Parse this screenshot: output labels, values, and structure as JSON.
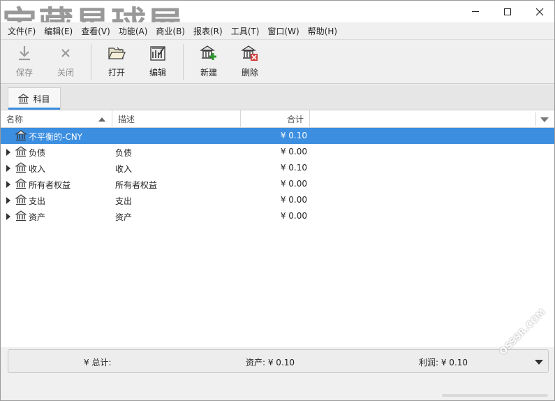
{
  "watermark": "宝藏星球屋",
  "corner_watermark": "OSSSR.COM",
  "menubar": {
    "items": [
      "文件(F)",
      "编辑(E)",
      "查看(V)",
      "功能(A)",
      "商业(B)",
      "报表(R)",
      "工具(T)",
      "窗口(W)",
      "帮助(H)"
    ]
  },
  "toolbar": {
    "save": "保存",
    "close": "关闭",
    "open": "打开",
    "edit": "编辑",
    "new": "新建",
    "delete": "删除"
  },
  "tabs": [
    {
      "label": "科目",
      "icon": "bank-icon"
    }
  ],
  "columns": {
    "name": "名称",
    "description": "描述",
    "total": "合计"
  },
  "accounts": [
    {
      "name": "不平衡的-CNY",
      "description": "",
      "total": "¥ 0.10",
      "selected": true,
      "expandable": false
    },
    {
      "name": "负债",
      "description": "负债",
      "total": "¥ 0.00",
      "selected": false,
      "expandable": true
    },
    {
      "name": "收入",
      "description": "收入",
      "total": "¥ 0.10",
      "selected": false,
      "expandable": true
    },
    {
      "name": "所有者权益",
      "description": "所有者权益",
      "total": "¥ 0.00",
      "selected": false,
      "expandable": true
    },
    {
      "name": "支出",
      "description": "支出",
      "total": "¥ 0.00",
      "selected": false,
      "expandable": true
    },
    {
      "name": "资产",
      "description": "资产",
      "total": "¥ 0.00",
      "selected": false,
      "expandable": true
    }
  ],
  "summary": {
    "label": "¥ 总计:",
    "assets": "资产: ¥ 0.10",
    "profit": "利润: ¥ 0.10"
  },
  "colors": {
    "selection": "#3b8ee0",
    "tab_underline": "#3b8ee0",
    "new_icon_plus": "#2e9a2e",
    "delete_icon_x": "#d23c3c"
  }
}
